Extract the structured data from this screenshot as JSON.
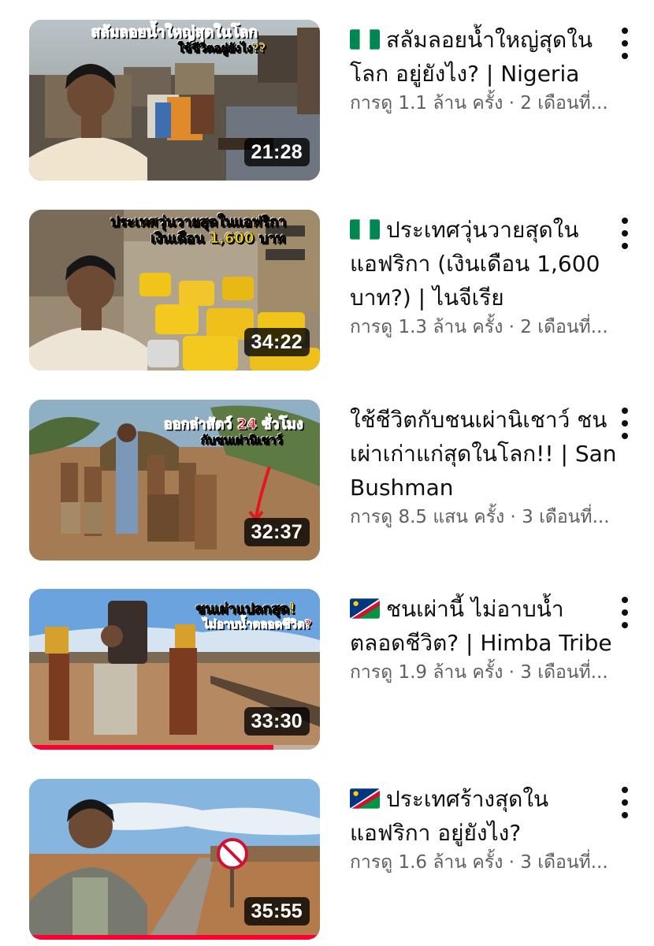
{
  "videos": [
    {
      "thumbnail_text": [
        "สลัมลอยน้ำใหญ่สุดในโลก",
        "ใช้ชีวิตอยู่ยังไง??"
      ],
      "duration": "21:28",
      "flag": "nigeria",
      "title": "สลัมลอยน้ำใหญ่สุดในโลก อยู่ยังไง? | Nigeria",
      "meta": "การดู 1.1 ล้าน ครั้ง · 2 เดือนที่...",
      "progress": 0
    },
    {
      "thumbnail_text": [
        "ประเทศวุ่นวายสุดในแอฟริกา",
        "เงินเดือน 1,600 บาท"
      ],
      "duration": "34:22",
      "flag": "nigeria",
      "title": "ประเทศวุ่นวายสุดในแอฟริกา (เงินเดือน 1,600 บาท?) | ไนจีเรีย",
      "meta": "การดู 1.3 ล้าน ครั้ง · 2 เดือนที่...",
      "progress": 0
    },
    {
      "thumbnail_text": [
        "ออกล่าสัตว์ 24 ชั่วโมง",
        "กับชนเผ่านิเชาว์"
      ],
      "duration": "32:37",
      "flag": "",
      "title": "ใช้ชีวิตกับชนเผ่านิเชาว์ ชนเผ่าเก่าแก่สุดในโลก!! | San Bushman",
      "meta": "การดู 8.5 แสน ครั้ง · 3 เดือนที่...",
      "progress": 0
    },
    {
      "thumbnail_text": [
        "ชนเผ่าแปลกสุด!",
        "ไม่อาบน้ำตลอดชีวิต?"
      ],
      "duration": "33:30",
      "flag": "namibia",
      "title": "ชนเผ่านี้ ไม่อาบน้ำ ตลอดชีวิต? | Himba Tribe",
      "meta": "การดู 1.9 ล้าน ครั้ง · 3 เดือนที่...",
      "progress": 0.84
    },
    {
      "thumbnail_text": [],
      "duration": "35:55",
      "flag": "namibia",
      "title": "ประเทศร้างสุดใน แอฟริกา อยู่ยังไง?",
      "meta": "การดู 1.6 ล้าน ครั้ง · 3 เดือนที่...",
      "progress": 1.0
    }
  ],
  "colors": {
    "progress": "#ff0033",
    "meta_text": "#606060",
    "title_text": "#0f0f0f"
  },
  "icons": {
    "more": "more-vert-icon"
  }
}
